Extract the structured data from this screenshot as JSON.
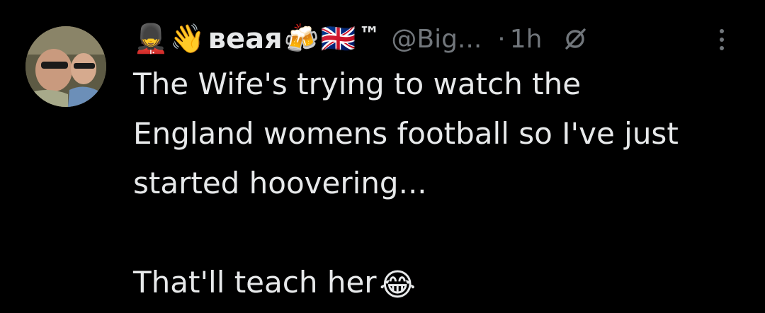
{
  "tweet": {
    "author": {
      "emoji_prefix_1": "💂",
      "emoji_prefix_2": "👋",
      "name": "веая",
      "emoji_suffix_1": "🍻",
      "emoji_suffix_2": "🇬🇧",
      "trademark": "™",
      "handle": "@Big...",
      "avatar_icon": "profile-photo"
    },
    "separator": "·",
    "time": "1h",
    "grok_icon": "grok-slash-icon",
    "more_icon": "more-vertical-icon",
    "body": {
      "line1": "The Wife's trying to watch the",
      "line2": "England womens football so I've just",
      "line3": "started hoovering...",
      "line4": "That'll  teach her",
      "emoji_end": "😂"
    }
  },
  "colors": {
    "background": "#000000",
    "text_primary": "#e7e9ea",
    "text_secondary": "#71767b"
  }
}
